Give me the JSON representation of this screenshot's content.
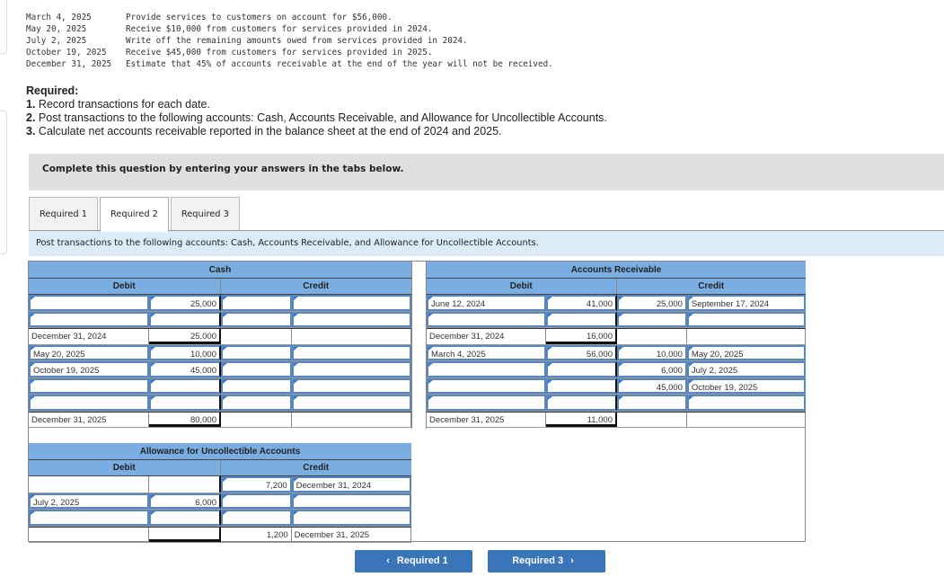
{
  "transactions": [
    {
      "date": "March 4, 2025",
      "text": "Provide services to customers on account for $56,000."
    },
    {
      "date": "May 20, 2025",
      "text": "Receive $10,000 from customers for services provided in 2024."
    },
    {
      "date": "July 2, 2025",
      "text": "Write off the remaining amounts owed from services provided in 2024."
    },
    {
      "date": "October 19, 2025",
      "text": "Receive $45,000 from customers for services provided in 2025."
    },
    {
      "date": "December 31, 2025",
      "text": "Estimate that 45% of accounts receivable at the end of the year will not be received."
    }
  ],
  "required": {
    "title": "Required:",
    "items": [
      {
        "num": "1.",
        "text": " Record transactions for each date."
      },
      {
        "num": "2.",
        "text": " Post transactions to the following accounts: Cash, Accounts Receivable, and Allowance for Uncollectible Accounts."
      },
      {
        "num": "3.",
        "text": " Calculate net accounts receivable reported in the balance sheet at the end of 2024 and 2025."
      }
    ]
  },
  "instruction": "Complete this question by entering your answers in the tabs below.",
  "tabs": [
    {
      "label": "Required 1",
      "active": false
    },
    {
      "label": "Required 2",
      "active": true
    },
    {
      "label": "Required 3",
      "active": false
    }
  ],
  "tab_description": "Post transactions to the following accounts: Cash, Accounts Receivable, and Allowance for Uncollectible Accounts.",
  "labels": {
    "debit": "Debit",
    "credit": "Credit"
  },
  "cash": {
    "title": "Cash",
    "rows": [
      {
        "d_date": "",
        "d_amt": "25,000",
        "c_amt": "",
        "c_date": ""
      },
      {
        "d_date": "",
        "d_amt": "",
        "c_amt": "",
        "c_date": ""
      },
      {
        "d_date": "December 31, 2024",
        "d_amt": "25,000",
        "c_amt": "",
        "c_date": ""
      },
      {
        "d_date": "May 20, 2025",
        "d_amt": "10,000",
        "c_amt": "",
        "c_date": ""
      },
      {
        "d_date": "October 19, 2025",
        "d_amt": "45,000",
        "c_amt": "",
        "c_date": ""
      },
      {
        "d_date": "",
        "d_amt": "",
        "c_amt": "",
        "c_date": ""
      },
      {
        "d_date": "",
        "d_amt": "",
        "c_amt": "",
        "c_date": ""
      },
      {
        "d_date": "December 31, 2025",
        "d_amt": "80,000",
        "c_amt": "",
        "c_date": ""
      }
    ]
  },
  "accounts_receivable": {
    "title": "Accounts Receivable",
    "rows": [
      {
        "d_date": "June 12, 2024",
        "d_amt": "41,000",
        "c_amt": "25,000",
        "c_date": "September 17, 2024"
      },
      {
        "d_date": "",
        "d_amt": "",
        "c_amt": "",
        "c_date": ""
      },
      {
        "d_date": "December 31, 2024",
        "d_amt": "16,000",
        "c_amt": "",
        "c_date": ""
      },
      {
        "d_date": "March 4, 2025",
        "d_amt": "56,000",
        "c_amt": "10,000",
        "c_date": "May 20, 2025"
      },
      {
        "d_date": "",
        "d_amt": "",
        "c_amt": "6,000",
        "c_date": "July 2, 2025"
      },
      {
        "d_date": "",
        "d_amt": "",
        "c_amt": "45,000",
        "c_date": "October 19, 2025"
      },
      {
        "d_date": "",
        "d_amt": "",
        "c_amt": "",
        "c_date": ""
      },
      {
        "d_date": "December 31, 2025",
        "d_amt": "11,000",
        "c_amt": "",
        "c_date": ""
      }
    ]
  },
  "allowance": {
    "title": "Allowance for Uncollectible Accounts",
    "rows": [
      {
        "d_date": "",
        "d_amt": "",
        "c_amt": "7,200",
        "c_date": "December 31, 2024"
      },
      {
        "d_date": "July 2, 2025",
        "d_amt": "6,000",
        "c_amt": "",
        "c_date": ""
      },
      {
        "d_date": "",
        "d_amt": "",
        "c_amt": "",
        "c_date": ""
      },
      {
        "d_date": "",
        "d_amt": "",
        "c_amt": "1,200",
        "c_date": "December 31, 2025"
      }
    ]
  },
  "nav": {
    "prev_label": "Required 1",
    "next_label": "Required 3",
    "prev_icon": "‹",
    "next_icon": "›"
  }
}
